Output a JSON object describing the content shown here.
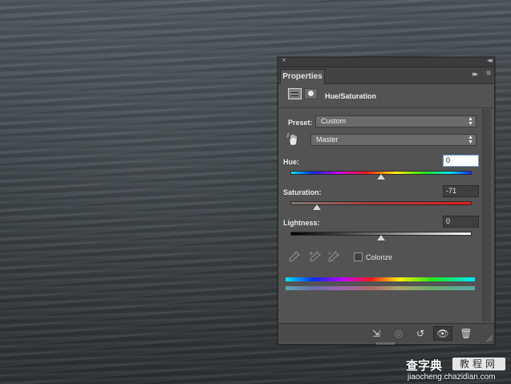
{
  "panel": {
    "tab_label": "Properties",
    "title": "Hue/Saturation",
    "close_glyph": "×",
    "collapse_glyph": "◂◂",
    "expand_glyph": "▸▸",
    "menu_glyph": "≡"
  },
  "preset": {
    "label": "Preset:",
    "value": "Custom"
  },
  "channel": {
    "value": "Master"
  },
  "hue": {
    "label": "Hue:",
    "value": "0",
    "slider_fraction": 0.5
  },
  "saturation": {
    "label": "Saturation:",
    "value": "-71",
    "slider_fraction": 0.145
  },
  "lightness": {
    "label": "Lightness:",
    "value": "0",
    "slider_fraction": 0.5
  },
  "colorize": {
    "label": "Colorize",
    "checked": false
  },
  "icons": {
    "adjustment": "adjustment-layer-icon",
    "mask": "layer-mask-icon",
    "hand": "targeted-adjustment-hand-icon",
    "eyedroppers": [
      "eyedropper-icon",
      "eyedropper-plus-icon",
      "eyedropper-minus-icon"
    ],
    "bottom": [
      "clip-to-layer-icon",
      "view-previous-state-icon",
      "reset-icon",
      "visibility-eye-icon",
      "trash-icon"
    ]
  },
  "colors": {
    "panel_bg": "#535353",
    "selected_tab": "#535353",
    "saturation_track_start": "#7a7a7a",
    "saturation_track_end": "#e21c1c"
  },
  "watermark": {
    "brand": "查字典",
    "tag": "教程网",
    "url": "jiaocheng.chazidian.com"
  }
}
